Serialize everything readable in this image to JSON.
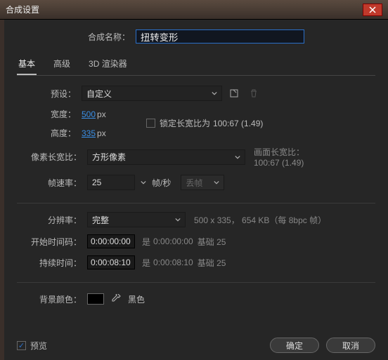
{
  "title": "合成设置",
  "compNameLabel": "合成名称：",
  "compName": "扭转变形",
  "tabs": {
    "basic": "基本",
    "advanced": "高级",
    "renderer": "3D 渲染器"
  },
  "preset": {
    "label": "预设：",
    "value": "自定义"
  },
  "width": {
    "label": "宽度：",
    "value": "500",
    "unit": "px"
  },
  "height": {
    "label": "高度：",
    "value": "335",
    "unit": "px"
  },
  "lockAspect": {
    "label": "锁定长宽比为",
    "ratio": "100:67 (1.49)"
  },
  "par": {
    "label": "像素长宽比：",
    "value": "方形像素"
  },
  "frameAspect": {
    "label": "画面长宽比：",
    "value": "100:67 (1.49)"
  },
  "frameRate": {
    "label": "帧速率：",
    "value": "25",
    "unit": "帧/秒",
    "drop": "丢帧"
  },
  "resolution": {
    "label": "分辨率：",
    "value": "完整",
    "info": "500 x 335， 654 KB（每 8bpc 帧）"
  },
  "startTC": {
    "label": "开始时间码：",
    "value": "0:00:00:00",
    "is": "是",
    "base": "0:00:00:00",
    "basis": "基础 25"
  },
  "duration": {
    "label": "持续时间：",
    "value": "0:00:08:10",
    "is": "是",
    "base": "0:00:08:10",
    "basis": "基础 25"
  },
  "bgColor": {
    "label": "背景颜色：",
    "name": "黑色"
  },
  "preview": "预览",
  "ok": "确定",
  "cancel": "取消"
}
